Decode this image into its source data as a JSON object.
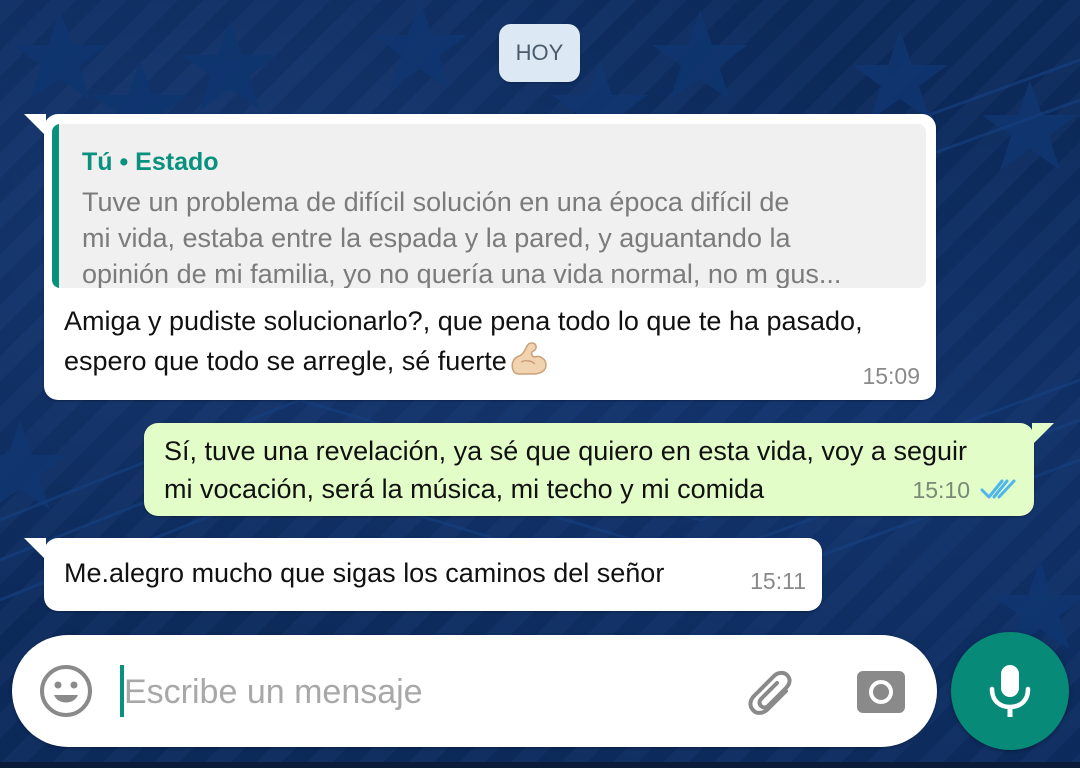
{
  "chat": {
    "date_chip": "HOY",
    "messages": [
      {
        "direction": "incoming",
        "reply": {
          "author": "Tú • Estado",
          "text": "Tuve un problema de difícil solución en una época difícil de\nmi vida, estaba entre la espada y la pared, y aguantando la\nopinión de mi familia, yo no quería una vida normal, no m gus..."
        },
        "text": "Amiga y pudiste solucionarlo?, que pena todo lo que te ha pasado,\nespero que todo se arregle, sé fuerte",
        "emoji": "flexed-biceps-emoji",
        "time": "15:09"
      },
      {
        "direction": "outgoing",
        "text": "Sí, tuve una revelación, ya sé que quiero en esta vida, voy a seguir\nmi vocación, será la música, mi techo y mi comida",
        "time": "15:10",
        "status": "read",
        "status_icon": "double-check-icon",
        "status_color": "#4fb6ec"
      },
      {
        "direction": "incoming",
        "text": "Me.alegro mucho que sigas los caminos del señor",
        "time": "15:11"
      }
    ]
  },
  "composer": {
    "placeholder": "Escribe un mensaje",
    "value": "",
    "emoji_icon": "smiley-icon",
    "attach_icon": "paperclip-icon",
    "camera_icon": "camera-icon",
    "mic_icon": "microphone-icon"
  },
  "colors": {
    "accent": "#07917e",
    "mic_button": "#078a78",
    "outgoing_bubble": "#e2fdc8",
    "incoming_bubble": "#ffffff",
    "wallpaper": "#0c2b5e"
  }
}
